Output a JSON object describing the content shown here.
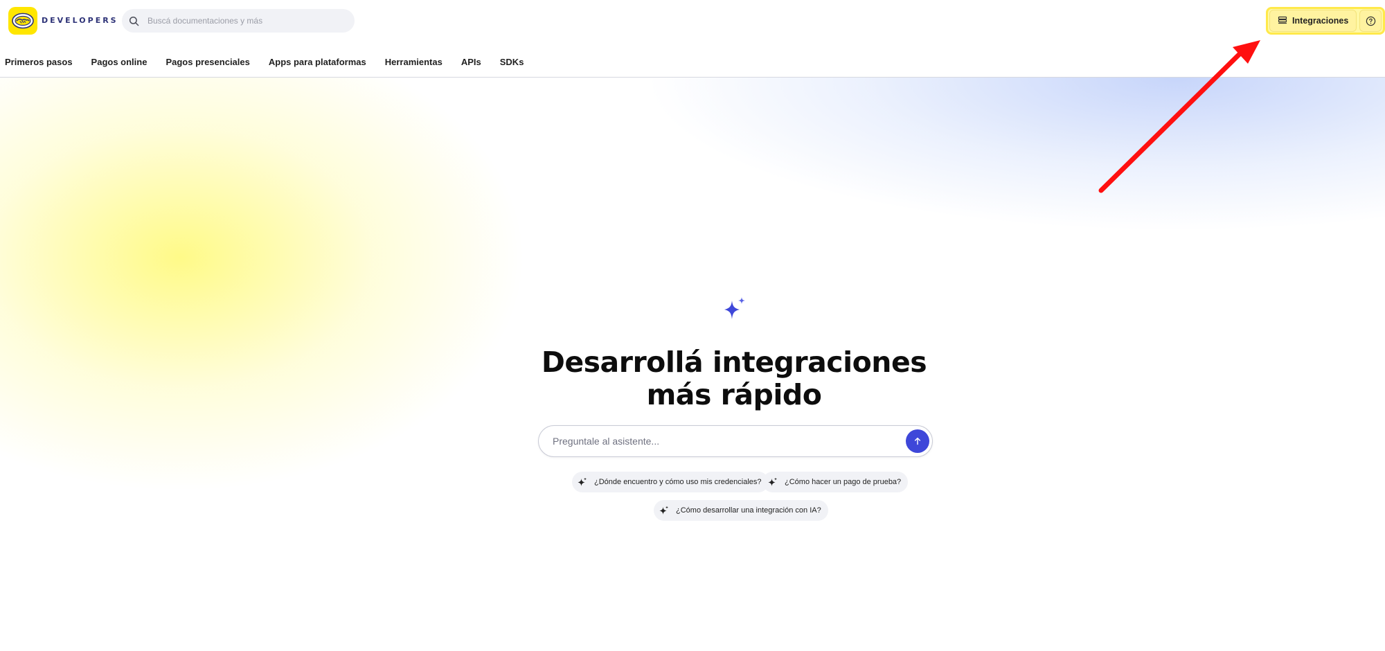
{
  "brand": {
    "logo_text": "DEVELOPERS",
    "accent": "#ffe600",
    "logo_text_color": "#2d3277",
    "logo_icon": "handshake-icon"
  },
  "search": {
    "placeholder": "Buscá documentaciones y más",
    "icon": "search-icon"
  },
  "nav": {
    "items": [
      {
        "label": "Primeros pasos"
      },
      {
        "label": "Pagos online"
      },
      {
        "label": "Pagos presenciales"
      },
      {
        "label": "Apps para plataformas"
      },
      {
        "label": "Herramientas"
      },
      {
        "label": "APIs"
      },
      {
        "label": "SDKs"
      }
    ]
  },
  "topright": {
    "integraciones_label": "Integraciones",
    "integraciones_icon": "stack-icon",
    "help_icon": "help-circle-icon",
    "highlight_color": "#ffe94a"
  },
  "hero": {
    "icon": "sparkle-icon",
    "title_line1": "Desarrollá integraciones",
    "title_line2": "más rápido",
    "ask_placeholder": "Preguntale al asistente...",
    "send_icon": "arrow-up-icon",
    "send_color": "#3e47d9",
    "suggestions": [
      {
        "label": "¿Dónde encuentro y cómo uso mis credenciales?"
      },
      {
        "label": "¿Cómo hacer un pago de prueba?"
      },
      {
        "label": "¿Cómo desarrollar una integración con IA?"
      }
    ]
  },
  "annotation": {
    "arrow_color": "#ff1010",
    "icon": "red-arrow-icon"
  }
}
